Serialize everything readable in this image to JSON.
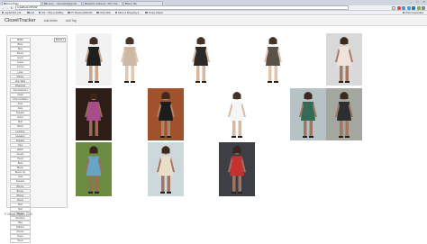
{
  "browser": {
    "tabs": [
      {
        "label": "Home Page",
        "active": true
      },
      {
        "label": "E-store - closetfeb2@gmail..."
      },
      {
        "label": "Apache Software / Mini Tips..."
      },
      {
        "label": "New Tab"
      }
    ],
    "url": "localhost:26720/",
    "bookmarks": [
      "appfetch01 | 24...",
      "osd",
      "Hill - 72hp to 2048hp",
      "TV Shows (2002-06)",
      "Violin Wiki",
      "Menu & Shopping &...",
      "Closet Clipper"
    ],
    "bookmarks_right": "Other bookmarks"
  },
  "app": {
    "brand": "ClosetTracker",
    "nav": [
      "Add Article",
      "Add Tag"
    ]
  },
  "sidebar": {
    "brands": [
      "BCBG",
      "Bebe",
      "Blue",
      "Dance",
      "Gucci",
      "Guess",
      "J.Crew",
      "Lulus",
      "Mango",
      "Nine West",
      "Patagonia",
      "Sam Edelman",
      "Uniqlo",
      "Urban Outfitters",
      "Zara",
      "Zara",
      "Sweater",
      "Jeans",
      "Skirt",
      "Boots",
      "Leggings",
      "Sweaters",
      "Sweater",
      "Tops",
      "Watch",
      "Jewelry",
      "Heels",
      "Belts",
      "Blazer",
      "Button-Up",
      "Coat",
      "Sweater",
      "Blouse",
      "Blouse",
      "Blouse",
      "Boots",
      "Shirt",
      "Skirt",
      "Shoes",
      "Necklace",
      "Bag",
      "Stilettos",
      "Pumps",
      "Dress",
      "Heels"
    ],
    "select_value": "Brand"
  },
  "footer": "© ClosetTracker 2012",
  "photos": [
    {
      "name": "outfit-photo-1"
    },
    {
      "name": "outfit-photo-2"
    },
    {
      "name": "outfit-photo-3"
    },
    {
      "name": "outfit-photo-4"
    },
    {
      "name": "outfit-photo-5"
    },
    {
      "name": "outfit-photo-6"
    },
    {
      "name": "outfit-photo-7"
    },
    {
      "name": "outfit-photo-8"
    },
    {
      "name": "outfit-photo-9"
    },
    {
      "name": "outfit-photo-10"
    },
    {
      "name": "outfit-photo-11"
    },
    {
      "name": "outfit-photo-12"
    },
    {
      "name": "outfit-photo-13"
    },
    {
      "name": "outfit-photo-14"
    }
  ]
}
